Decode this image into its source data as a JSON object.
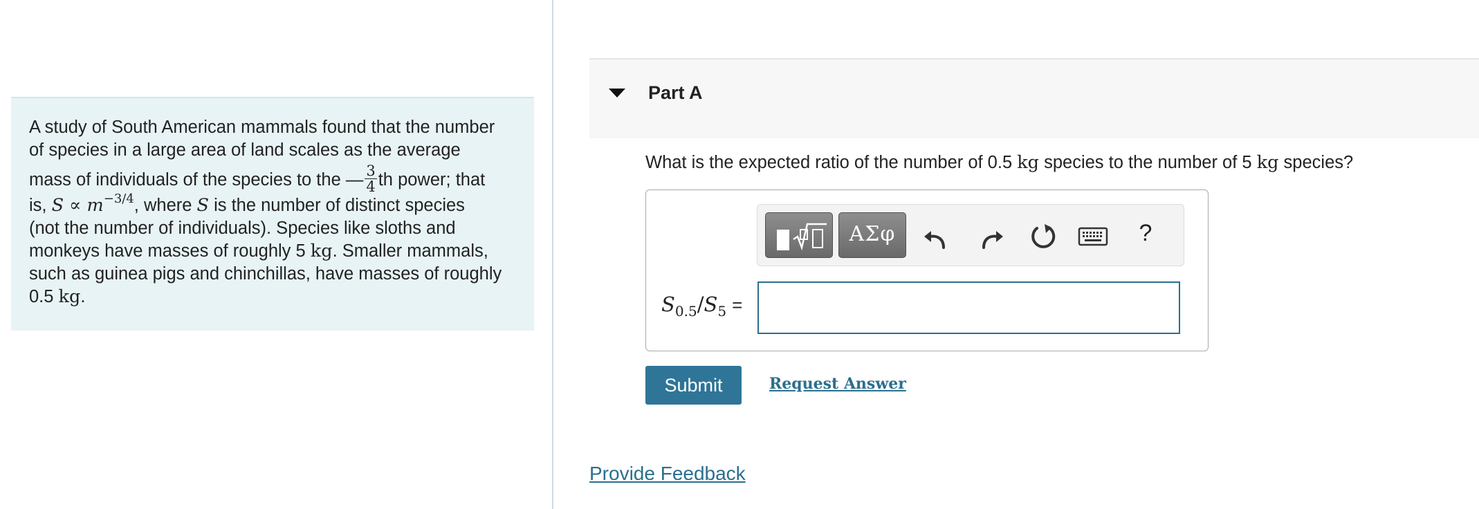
{
  "problem": {
    "line1": "A study of South American mammals found that the number",
    "line2": "of species in a large area of land scales as the average",
    "line3_pre": "mass of individuals of the species to the ",
    "frac_sign": "—",
    "frac_num": "3",
    "frac_den": "4",
    "line3_post": "th power; that",
    "line4_pre": "is, ",
    "var_S": "S",
    "propto": " ∝ ",
    "var_m": "m",
    "exponent": "−3/4",
    "line4_mid": ", where ",
    "line4_post": " is the number of distinct species",
    "line5": "(not the number of individuals). Species like sloths and",
    "line6_pre": "monkeys have masses of roughly 5 ",
    "unit_kg": "kg",
    "line6_post": ". Smaller mammals,",
    "line7": "such as guinea pigs and chinchillas, have masses of roughly",
    "line8_pre": "0.5 ",
    "line8_post": "."
  },
  "part": {
    "title": "Part A"
  },
  "question": {
    "pre": "What is the expected ratio of the number of 0.5 ",
    "unit": "kg",
    "mid": " species to the number of 5 ",
    "post": " species?"
  },
  "toolbar": {
    "symbols_label": "ΑΣφ",
    "help_label": "?"
  },
  "answer": {
    "label_S": "S",
    "label_sub1": "0.5",
    "label_slash": "/",
    "label_sub2": "5",
    "label_eq": "=",
    "value": ""
  },
  "actions": {
    "submit": "Submit",
    "request_answer": "Request Answer",
    "provide_feedback": "Provide Feedback"
  },
  "colors": {
    "accent": "#2f7597",
    "link": "#2b6f8e",
    "problem_bg": "#e8f3f5"
  }
}
